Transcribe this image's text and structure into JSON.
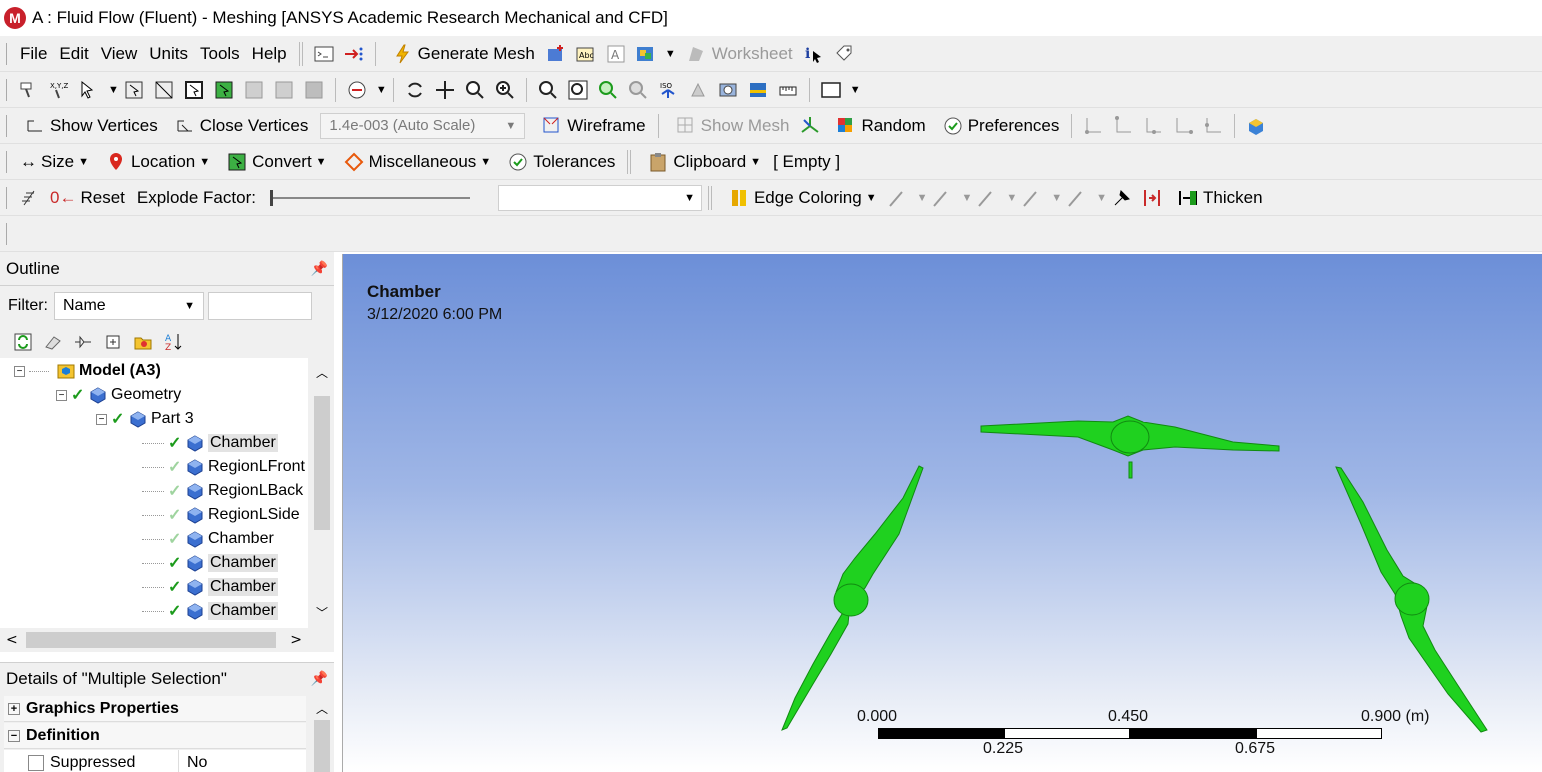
{
  "window": {
    "logo_letter": "M",
    "title": "A : Fluid Flow (Fluent) - Meshing [ANSYS Academic Research Mechanical and CFD]"
  },
  "menu": {
    "items": [
      "File",
      "Edit",
      "View",
      "Units",
      "Tools",
      "Help"
    ],
    "generate_mesh": "Generate Mesh",
    "worksheet": "Worksheet"
  },
  "toolbar3": {
    "show_vertices": "Show Vertices",
    "close_vertices": "Close Vertices",
    "scale_value": "1.4e-003 (Auto Scale)",
    "wireframe": "Wireframe",
    "show_mesh": "Show Mesh",
    "random": "Random",
    "preferences": "Preferences"
  },
  "toolbar4": {
    "size": "Size",
    "location": "Location",
    "convert": "Convert",
    "miscellaneous": "Miscellaneous",
    "tolerances": "Tolerances",
    "clipboard": "Clipboard",
    "clipboard_state": "[ Empty ]"
  },
  "toolbar5": {
    "reset": "Reset",
    "explode_factor": "Explode Factor:",
    "explode_value": 0,
    "edge_coloring": "Edge Coloring",
    "thicken": "Thicken"
  },
  "outline": {
    "title": "Outline",
    "filter_label": "Filter:",
    "filter_value": "Name",
    "tree": [
      {
        "label": "Model (A3)",
        "bold": true
      },
      {
        "label": "Geometry"
      },
      {
        "label": "Part 3"
      },
      {
        "label": "Chamber",
        "selected": true,
        "check": "solid"
      },
      {
        "label": "RegionLFront",
        "check": "light"
      },
      {
        "label": "RegionLBack",
        "check": "light"
      },
      {
        "label": "RegionLSide",
        "check": "light"
      },
      {
        "label": "Chamber",
        "check": "light"
      },
      {
        "label": "Chamber",
        "selected": true,
        "check": "solid"
      },
      {
        "label": "Chamber",
        "selected": true,
        "check": "solid"
      },
      {
        "label": "Chamber",
        "selected": true,
        "check": "solid"
      }
    ]
  },
  "details": {
    "title": "Details of \"Multiple Selection\"",
    "graphics_properties": "Graphics Properties",
    "definition": "Definition",
    "suppressed_label": "Suppressed",
    "suppressed_value": "No"
  },
  "viewport": {
    "object_title": "Chamber",
    "date": "3/12/2020 6:00 PM",
    "scale": {
      "top_labels": [
        "0.000",
        "0.450",
        "0.900 (m)"
      ],
      "bottom_labels": [
        "0.225",
        "0.675"
      ]
    },
    "geometry_color": "#1fd11f"
  },
  "colors": {
    "accent_check": "#1c9b1c",
    "viewport_top": "#6c8fd8",
    "app_logo": "#c8202b"
  }
}
